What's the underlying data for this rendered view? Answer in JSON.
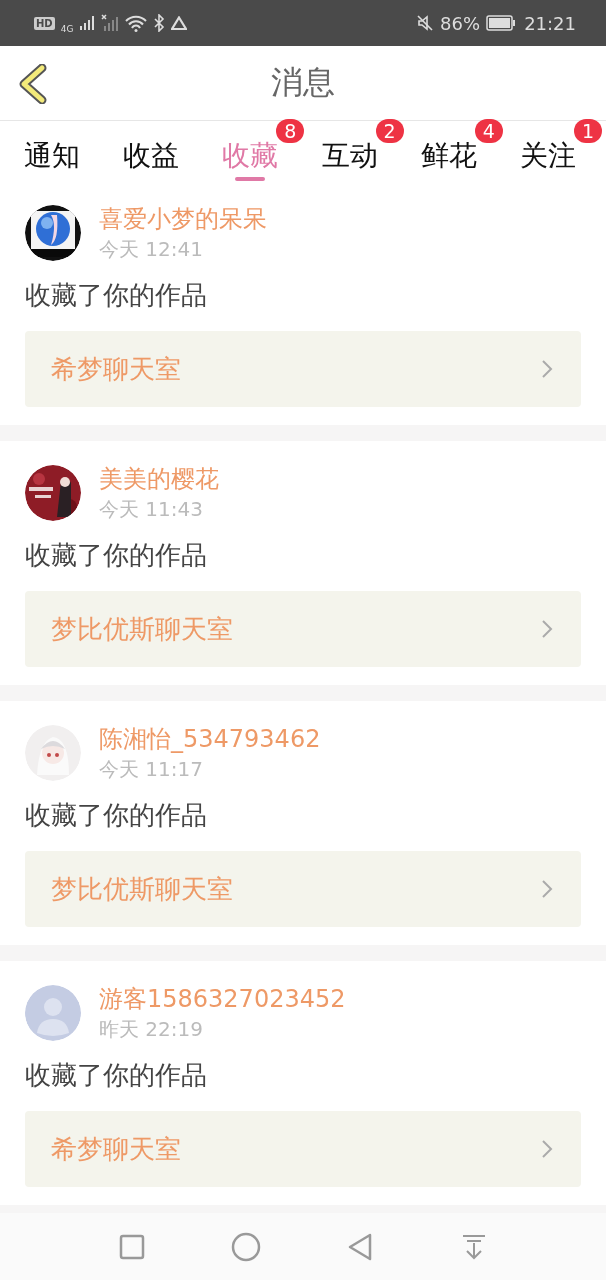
{
  "status_bar": {
    "hd": "HD",
    "network": "4G",
    "battery": "86%",
    "time": "21:21"
  },
  "header": {
    "title": "消息"
  },
  "tabs": [
    {
      "label": "通知",
      "selected": false
    },
    {
      "label": "收益",
      "selected": false
    },
    {
      "label": "收藏",
      "selected": true,
      "badge": "8"
    },
    {
      "label": "互动",
      "selected": false,
      "badge": "2"
    },
    {
      "label": "鲜花",
      "selected": false,
      "badge": "4"
    },
    {
      "label": "关注",
      "selected": false,
      "badge": "1"
    }
  ],
  "messages": [
    {
      "user": "喜爱小梦的呆呆",
      "time": "今天 12:41",
      "action": "收藏了你的作品",
      "work": "希梦聊天室"
    },
    {
      "user": "美美的樱花",
      "time": "今天 11:43",
      "action": "收藏了你的作品",
      "work": "梦比优斯聊天室"
    },
    {
      "user": "陈湘怡_534793462",
      "time": "今天 11:17",
      "action": "收藏了你的作品",
      "work": "梦比优斯聊天室"
    },
    {
      "user": "游客1586327023452",
      "time": "昨天 22:19",
      "avatar": {
        "kind": "default"
      },
      "action": "收藏了你的作品",
      "work": "希梦聊天室"
    }
  ]
}
